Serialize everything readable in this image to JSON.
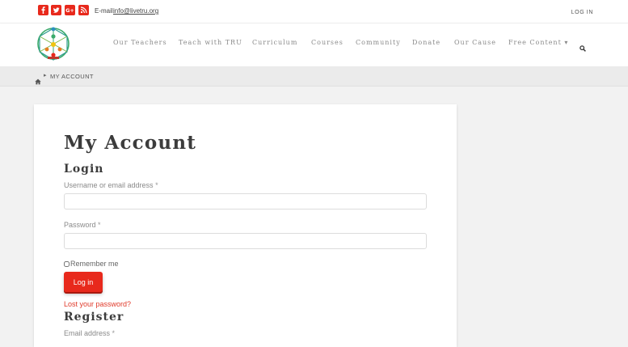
{
  "topbar": {
    "email_label": "E-mail:",
    "email": "info@livetru.org",
    "login": "LOG IN",
    "social": [
      {
        "name": "facebook-icon",
        "color": "#e8291c"
      },
      {
        "name": "twitter-icon",
        "color": "#e8291c"
      },
      {
        "name": "google-plus-icon",
        "color": "#e8291c"
      },
      {
        "name": "rss-icon",
        "color": "#e8291c"
      }
    ]
  },
  "nav": {
    "items": [
      {
        "label": "Our Teachers"
      },
      {
        "label": "Teach with TRU"
      },
      {
        "label": "Curriculum"
      },
      {
        "label": "Courses"
      },
      {
        "label": "Community"
      },
      {
        "label": "Donate"
      },
      {
        "label": "Our Cause"
      },
      {
        "label": "Free Content ▾"
      }
    ]
  },
  "breadcrumb": {
    "current": "MY ACCOUNT"
  },
  "account": {
    "title": "My Account",
    "login": {
      "heading": "Login",
      "username_label": "Username or email address",
      "password_label": "Password",
      "required_mark": "*",
      "remember_label": "Remember me",
      "submit_label": "Log in",
      "lost_password": "Lost your password?"
    },
    "register": {
      "heading": "Register",
      "email_label": "Email address",
      "required_mark": "*"
    }
  },
  "colors": {
    "accent": "#e8291c",
    "link": "#e03a2a"
  }
}
